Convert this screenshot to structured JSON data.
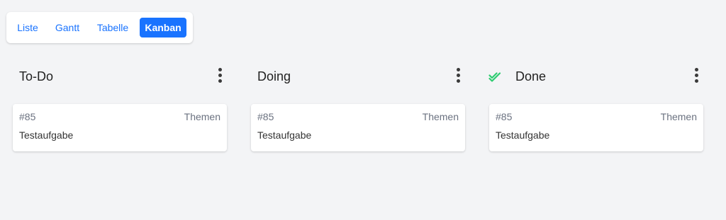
{
  "views": {
    "tabs": [
      {
        "label": "Liste"
      },
      {
        "label": "Gantt"
      },
      {
        "label": "Tabelle"
      },
      {
        "label": "Kanban"
      }
    ],
    "active": "Kanban"
  },
  "colors": {
    "accent": "#1973ff",
    "done_check": "#2ecc71",
    "background": "#f3f4f6"
  },
  "buckets": [
    {
      "title": "To-Do",
      "icon": null,
      "menu_icon": "kebab-menu-icon",
      "tasks": [
        {
          "id": "#85",
          "project": "Themen",
          "title": "Testaufgabe"
        }
      ]
    },
    {
      "title": "Doing",
      "icon": null,
      "menu_icon": "kebab-menu-icon",
      "tasks": [
        {
          "id": "#85",
          "project": "Themen",
          "title": "Testaufgabe"
        }
      ]
    },
    {
      "title": "Done",
      "icon": "double-check-icon",
      "menu_icon": "kebab-menu-icon",
      "tasks": [
        {
          "id": "#85",
          "project": "Themen",
          "title": "Testaufgabe"
        }
      ]
    }
  ]
}
